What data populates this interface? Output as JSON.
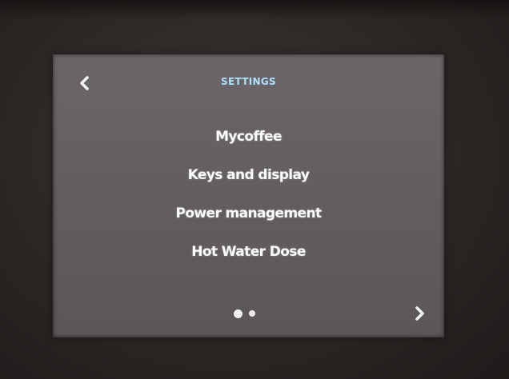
{
  "header": {
    "title": "SETTINGS",
    "back_icon": "chevron-left-icon"
  },
  "menu": {
    "items": [
      {
        "label": "Mycoffee"
      },
      {
        "label": "Keys and display"
      },
      {
        "label": "Power management"
      },
      {
        "label": "Hot Water Dose"
      }
    ]
  },
  "pagination": {
    "current_page": 1,
    "total_pages": 2,
    "next_icon": "chevron-right-icon"
  },
  "colors": {
    "screen_background": "#625e62",
    "title_text": "#aee0f7",
    "menu_text": "#fbfbfd",
    "bezel": "#2c2725"
  }
}
